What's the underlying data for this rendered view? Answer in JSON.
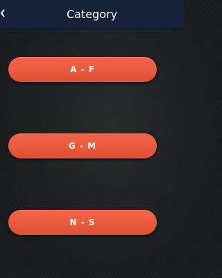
{
  "header": {
    "title": "Category",
    "back_icon": "back-arrow-icon",
    "background_color": "#152238"
  },
  "categories": [
    {
      "label": "A - F"
    },
    {
      "label": "G - M"
    },
    {
      "label": "N - S"
    }
  ],
  "colors": {
    "button": "#ef5b3f",
    "page_background": "#1b1c1e",
    "text": "#ffffff"
  }
}
